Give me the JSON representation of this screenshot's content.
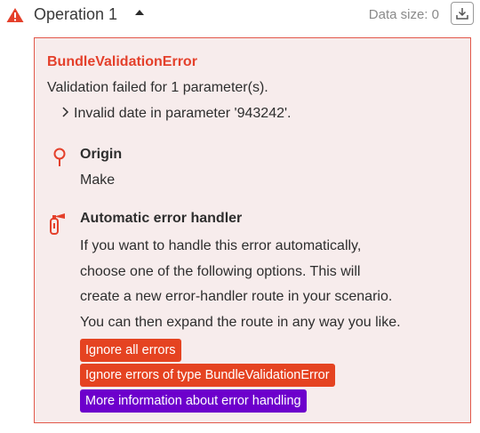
{
  "header": {
    "title": "Operation 1",
    "data_size": "Data size: 0",
    "colors": {
      "warning": "#e4402b"
    }
  },
  "error": {
    "name": "BundleValidationError",
    "message": "Validation failed for 1 parameter(s).",
    "detail": "Invalid date in parameter '943242'."
  },
  "origin": {
    "title": "Origin",
    "value": "Make"
  },
  "handler": {
    "title": "Automatic error handler",
    "description_lines": [
      "If you want to handle this error automatically,",
      "choose one of the following options. This will",
      "create a new error-handler route in your scenario.",
      "You can then expand the route in any way you like."
    ],
    "buttons": {
      "ignore_all": "Ignore all errors",
      "ignore_type": "Ignore errors of type BundleValidationError",
      "more_info": "More information about error handling"
    }
  },
  "colors": {
    "accent_red": "#e54321",
    "accent_purple": "#6d00cc",
    "panel_bg": "#f7ecec",
    "panel_border": "#e2584a"
  }
}
